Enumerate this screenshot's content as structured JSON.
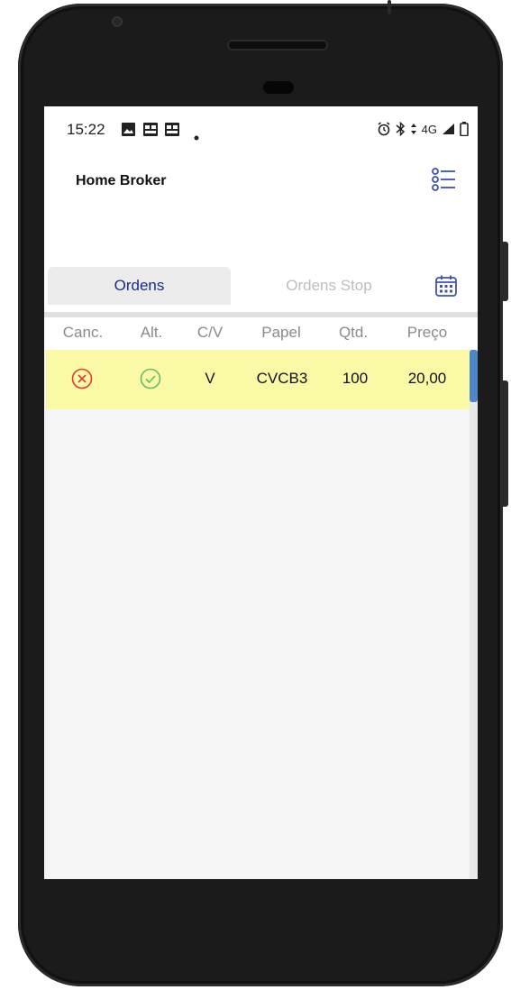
{
  "status_bar": {
    "time": "15:22",
    "network": "4G"
  },
  "app": {
    "title": "Home Broker"
  },
  "tabs": [
    {
      "label": "Ordens",
      "active": true
    },
    {
      "label": "Ordens Stop",
      "active": false
    }
  ],
  "table": {
    "columns": [
      "Canc.",
      "Alt.",
      "C/V",
      "Papel",
      "Qtd.",
      "Preço"
    ],
    "rows": [
      {
        "side": "V",
        "ticker": "CVCB3",
        "quantity": "100",
        "price": "20,00"
      }
    ]
  },
  "icons": {
    "cancel": "cancel-circle-icon",
    "edit": "check-circle-icon",
    "menu": "list-menu-icon",
    "calendar": "calendar-icon"
  },
  "colors": {
    "accent": "#1a2a8f",
    "icon_blue": "#3f51b5",
    "cancel_red": "#e53935",
    "alter_green": "#66bb6a",
    "row_highlight": "#fafaa6",
    "scroll_thumb": "#4e86c7"
  }
}
